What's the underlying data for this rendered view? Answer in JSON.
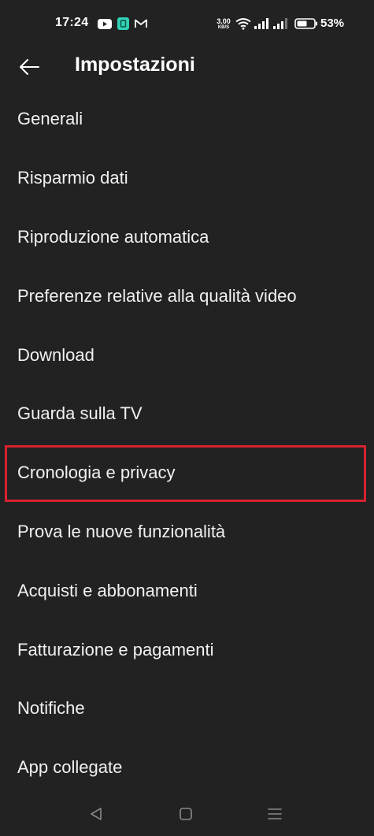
{
  "status_bar": {
    "time": "17:24",
    "net_speed_value": "3.00",
    "net_speed_unit": "KB/S",
    "battery_percent": "53%",
    "icons": [
      "youtube-icon",
      "app-notification-icon",
      "gmail-icon",
      "wifi-icon",
      "signal-icon",
      "signal-icon",
      "battery-icon"
    ]
  },
  "app_bar": {
    "title": "Impostazioni",
    "back_icon": "arrow-left-icon"
  },
  "settings": {
    "items": [
      {
        "label": "Generali"
      },
      {
        "label": "Risparmio dati"
      },
      {
        "label": "Riproduzione automatica"
      },
      {
        "label": "Preferenze relative alla qualità video"
      },
      {
        "label": "Download"
      },
      {
        "label": "Guarda sulla TV"
      },
      {
        "label": "Cronologia e privacy",
        "highlighted": true
      },
      {
        "label": "Prova le nuove funzionalità"
      },
      {
        "label": "Acquisti e abbonamenti"
      },
      {
        "label": "Fatturazione e pagamenti"
      },
      {
        "label": "Notifiche"
      },
      {
        "label": "App collegate"
      }
    ]
  },
  "nav_bar": {
    "buttons": [
      "triangle-back-icon",
      "square-home-icon",
      "menu-recents-icon"
    ]
  },
  "colors": {
    "background": "#222222",
    "text": "#f1f1f1",
    "highlight_border": "#d6232e"
  }
}
